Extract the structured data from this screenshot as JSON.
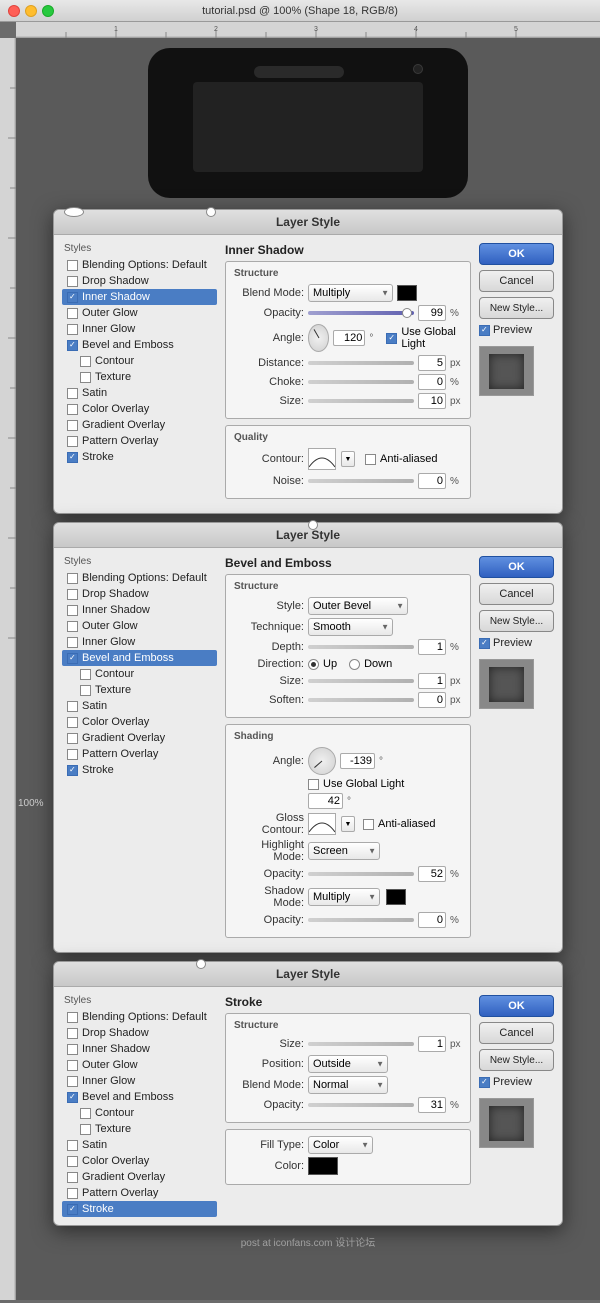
{
  "app": {
    "title": "tutorial.psd @ 100% (Shape 18, RGB/8)",
    "watermark": "post at iconfans.com 设计论坛"
  },
  "traffic_lights": {
    "red": "close",
    "yellow": "minimize",
    "green": "maximize"
  },
  "zoom_label": "100%",
  "dialogs": [
    {
      "title": "Layer Style",
      "active_section": "Inner Shadow",
      "styles": [
        {
          "label": "Styles",
          "type": "header"
        },
        {
          "label": "Blending Options: Default",
          "checked": false,
          "selected": false
        },
        {
          "label": "Drop Shadow",
          "checked": false,
          "selected": false
        },
        {
          "label": "Inner Shadow",
          "checked": true,
          "selected": true
        },
        {
          "label": "Outer Glow",
          "checked": false,
          "selected": false
        },
        {
          "label": "Inner Glow",
          "checked": false,
          "selected": false
        },
        {
          "label": "Bevel and Emboss",
          "checked": true,
          "selected": false
        },
        {
          "label": "Contour",
          "checked": false,
          "selected": false,
          "indented": true
        },
        {
          "label": "Texture",
          "checked": false,
          "selected": false,
          "indented": true
        },
        {
          "label": "Satin",
          "checked": false,
          "selected": false
        },
        {
          "label": "Color Overlay",
          "checked": false,
          "selected": false
        },
        {
          "label": "Gradient Overlay",
          "checked": false,
          "selected": false
        },
        {
          "label": "Pattern Overlay",
          "checked": false,
          "selected": false
        },
        {
          "label": "Stroke",
          "checked": true,
          "selected": false
        }
      ],
      "inner_shadow": {
        "structure": {
          "blend_mode": "Multiply",
          "color": "#000000",
          "opacity": "99",
          "angle": "120",
          "use_global_light": true,
          "distance": "5",
          "distance_unit": "px",
          "choke": "0",
          "choke_unit": "%",
          "size": "10",
          "size_unit": "px"
        },
        "quality": {
          "anti_aliased": false,
          "noise": "0",
          "noise_unit": "%"
        }
      },
      "buttons": {
        "ok": "OK",
        "cancel": "Cancel",
        "new_style": "New Style...",
        "preview_label": "Preview"
      }
    },
    {
      "title": "Layer Style",
      "active_section": "Bevel and Emboss",
      "styles": [
        {
          "label": "Styles",
          "type": "header"
        },
        {
          "label": "Blending Options: Default",
          "checked": false,
          "selected": false
        },
        {
          "label": "Drop Shadow",
          "checked": false,
          "selected": false
        },
        {
          "label": "Inner Shadow",
          "checked": false,
          "selected": false
        },
        {
          "label": "Outer Glow",
          "checked": false,
          "selected": false
        },
        {
          "label": "Inner Glow",
          "checked": false,
          "selected": false
        },
        {
          "label": "Bevel and Emboss",
          "checked": true,
          "selected": true
        },
        {
          "label": "Contour",
          "checked": false,
          "selected": false,
          "indented": true
        },
        {
          "label": "Texture",
          "checked": false,
          "selected": false,
          "indented": true
        },
        {
          "label": "Satin",
          "checked": false,
          "selected": false
        },
        {
          "label": "Color Overlay",
          "checked": false,
          "selected": false
        },
        {
          "label": "Gradient Overlay",
          "checked": false,
          "selected": false
        },
        {
          "label": "Pattern Overlay",
          "checked": false,
          "selected": false
        },
        {
          "label": "Stroke",
          "checked": true,
          "selected": false
        }
      ],
      "bevel_emboss": {
        "structure": {
          "style": "Outer Bevel",
          "technique": "Smooth",
          "depth": "1",
          "depth_unit": "%",
          "direction_up": true,
          "size": "1",
          "size_unit": "px",
          "soften": "0",
          "soften_unit": "px"
        },
        "shading": {
          "angle": "-139",
          "use_global_light": false,
          "altitude": "42",
          "gloss_contour_label": "Gloss Contour:",
          "anti_aliased": false,
          "highlight_mode": "Screen",
          "highlight_opacity": "52",
          "shadow_mode": "Multiply",
          "shadow_color": "#000000",
          "shadow_opacity": "0"
        }
      },
      "buttons": {
        "ok": "OK",
        "cancel": "Cancel",
        "new_style": "New Style...",
        "preview_label": "Preview"
      }
    },
    {
      "title": "Layer Style",
      "active_section": "Stroke",
      "styles": [
        {
          "label": "Styles",
          "type": "header"
        },
        {
          "label": "Blending Options: Default",
          "checked": false,
          "selected": false
        },
        {
          "label": "Drop Shadow",
          "checked": false,
          "selected": false
        },
        {
          "label": "Inner Shadow",
          "checked": false,
          "selected": false
        },
        {
          "label": "Outer Glow",
          "checked": false,
          "selected": false
        },
        {
          "label": "Inner Glow",
          "checked": false,
          "selected": false
        },
        {
          "label": "Bevel and Emboss",
          "checked": true,
          "selected": false
        },
        {
          "label": "Contour",
          "checked": false,
          "selected": false,
          "indented": true
        },
        {
          "label": "Texture",
          "checked": false,
          "selected": false,
          "indented": true
        },
        {
          "label": "Satin",
          "checked": false,
          "selected": false
        },
        {
          "label": "Color Overlay",
          "checked": false,
          "selected": false
        },
        {
          "label": "Gradient Overlay",
          "checked": false,
          "selected": false
        },
        {
          "label": "Pattern Overlay",
          "checked": false,
          "selected": false
        },
        {
          "label": "Stroke",
          "checked": true,
          "selected": true
        }
      ],
      "stroke": {
        "structure": {
          "size": "1",
          "size_unit": "px",
          "position": "Outside",
          "blend_mode": "Normal",
          "opacity": "31",
          "opacity_unit": "%",
          "fill_type": "Color",
          "color": "#000000"
        }
      },
      "buttons": {
        "ok": "OK",
        "cancel": "Cancel",
        "new_style": "New Style...",
        "preview_label": "Preview"
      }
    }
  ]
}
